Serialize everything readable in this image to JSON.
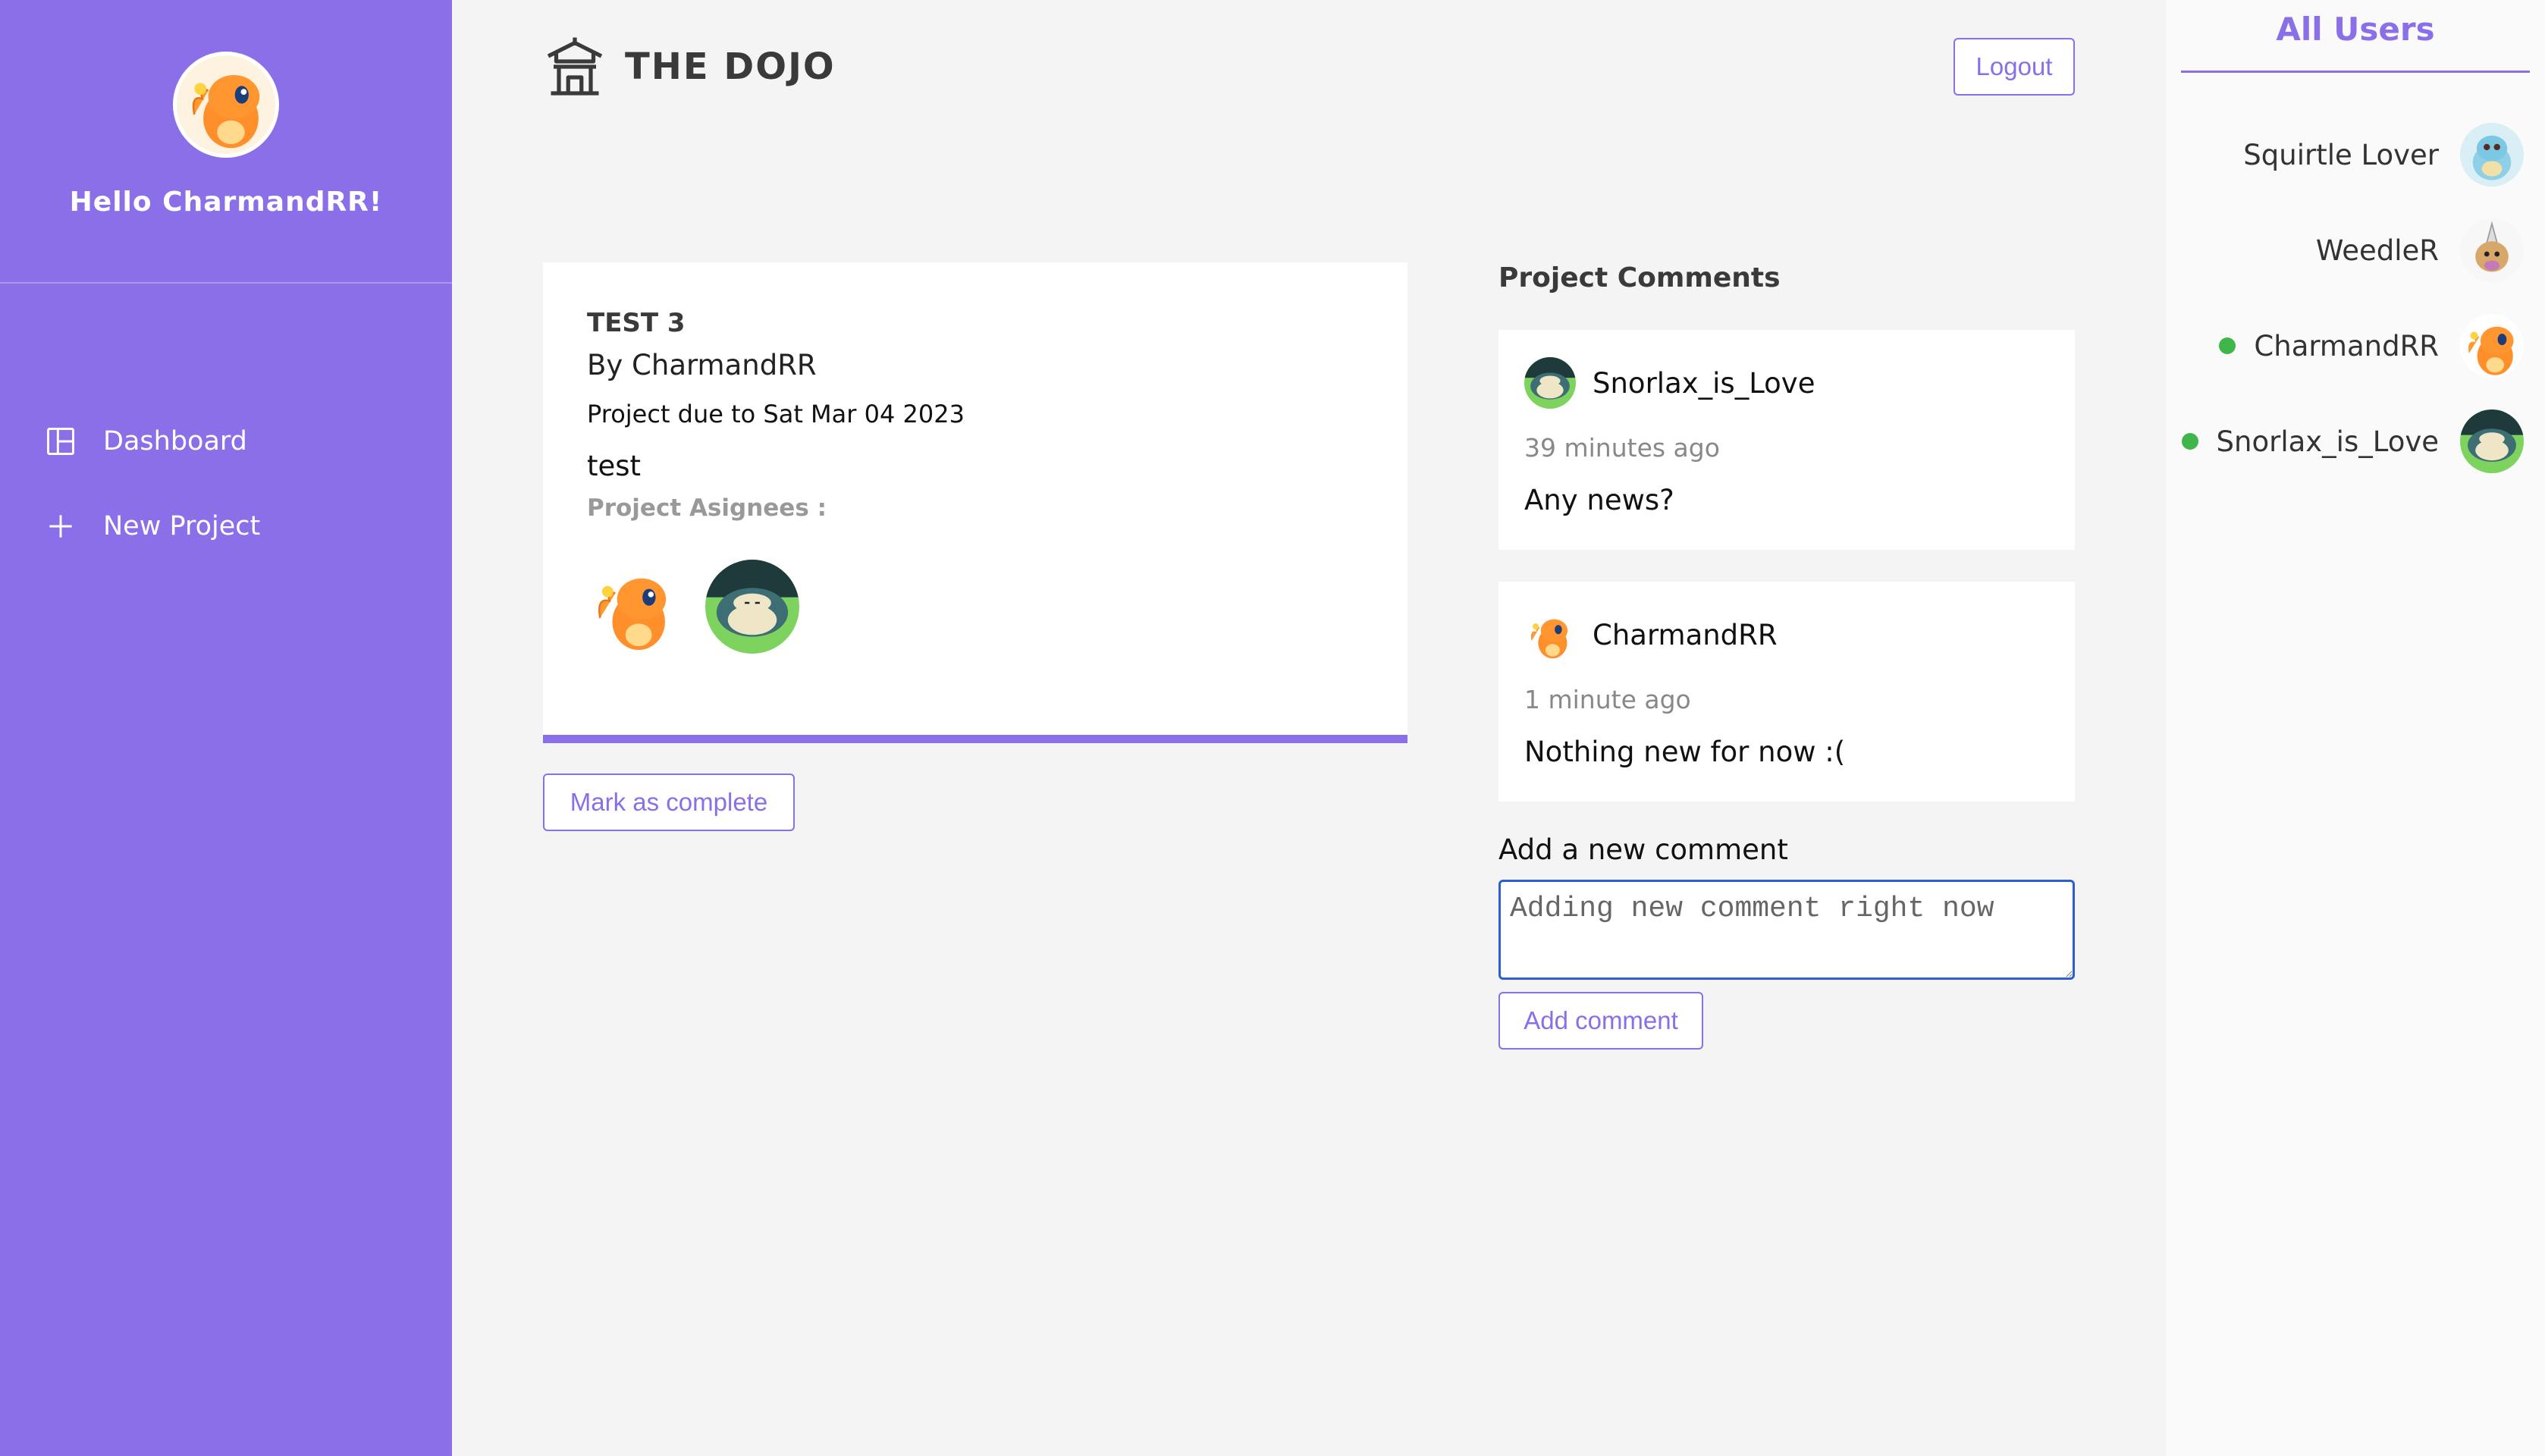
{
  "sidebar": {
    "greeting": "Hello CharmandRR!",
    "avatar_icon": "charmander-avatar-icon",
    "nav": [
      {
        "label": "Dashboard",
        "icon": "dashboard-icon"
      },
      {
        "label": "New Project",
        "icon": "plus-icon"
      }
    ]
  },
  "header": {
    "brand": "THE DOJO",
    "brand_icon": "temple-icon",
    "logout_label": "Logout"
  },
  "project": {
    "title": "TEST 3",
    "by": "By CharmandRR",
    "due": "Project due to Sat Mar 04 2023",
    "description": "test",
    "assignees_label": "Project Asignees :",
    "assignees": [
      "charmander-avatar-icon",
      "snorlax-avatar-icon"
    ],
    "mark_complete_label": "Mark as complete"
  },
  "comments": {
    "heading": "Project Comments",
    "items": [
      {
        "author": "Snorlax_is_Love",
        "time": "39 minutes ago",
        "body": "Any news?",
        "avatar": "snorlax-avatar-icon"
      },
      {
        "author": "CharmandRR",
        "time": "1 minute ago",
        "body": "Nothing new for now :(",
        "avatar": "charmander-avatar-icon"
      }
    ],
    "add_label": "Add a new comment",
    "input_value": "Adding new comment right now",
    "add_button_label": "Add comment"
  },
  "users": {
    "heading": "All Users",
    "items": [
      {
        "name": "Squirtle Lover",
        "online": false,
        "avatar": "squirtle-avatar-icon"
      },
      {
        "name": "WeedleR",
        "online": false,
        "avatar": "weedle-avatar-icon"
      },
      {
        "name": "CharmandRR",
        "online": true,
        "avatar": "charmander-avatar-icon"
      },
      {
        "name": "Snorlax_is_Love",
        "online": true,
        "avatar": "snorlax-avatar-icon"
      }
    ]
  },
  "colors": {
    "accent": "#8a6fe8",
    "online": "#3fb54a",
    "input_focus": "#2b5fd1"
  }
}
